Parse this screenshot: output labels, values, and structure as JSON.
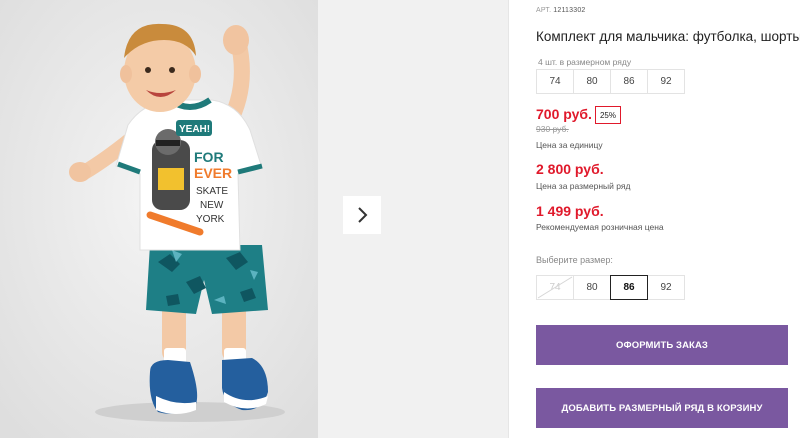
{
  "product": {
    "article_label": "АРТ.",
    "article_number": "12113302",
    "title": "Комплект для мальчика: футболка, шорты",
    "row_caption": "4 шт. в размерном ряду",
    "row_sizes": [
      "74",
      "80",
      "86",
      "92"
    ],
    "price": "700 руб.",
    "discount": "25%",
    "old_price": "930 руб.",
    "unit_caption": "Цена за единицу",
    "row_price": "2 800 руб.",
    "row_price_caption": "Цена за размерный ряд",
    "retail_price": "1 499 руб.",
    "retail_caption": "Рекомендуемая розничная цена",
    "choose_size_label": "Выберите размер:",
    "size_options": [
      {
        "label": "74",
        "state": "disabled"
      },
      {
        "label": "80",
        "state": "available"
      },
      {
        "label": "86",
        "state": "selected"
      },
      {
        "label": "92",
        "state": "available"
      }
    ],
    "order_button": "ОФОРМИТЬ ЗАКАЗ",
    "cart_button": "ДОБАВИТЬ РАЗМЕРНЫЙ РЯД В КОРЗИНУ"
  },
  "gallery": {
    "next_icon": "chevron-right-icon",
    "tshirt_print_lines": [
      "YEAH!",
      "FOR",
      "EVER",
      "SKATE",
      "NEW",
      "YORK"
    ]
  },
  "colors": {
    "accent_purple": "#7a58a0",
    "price_red": "#e0192b",
    "tshirt_trim": "#1f7a7a",
    "shorts_teal": "#1e7f86"
  }
}
